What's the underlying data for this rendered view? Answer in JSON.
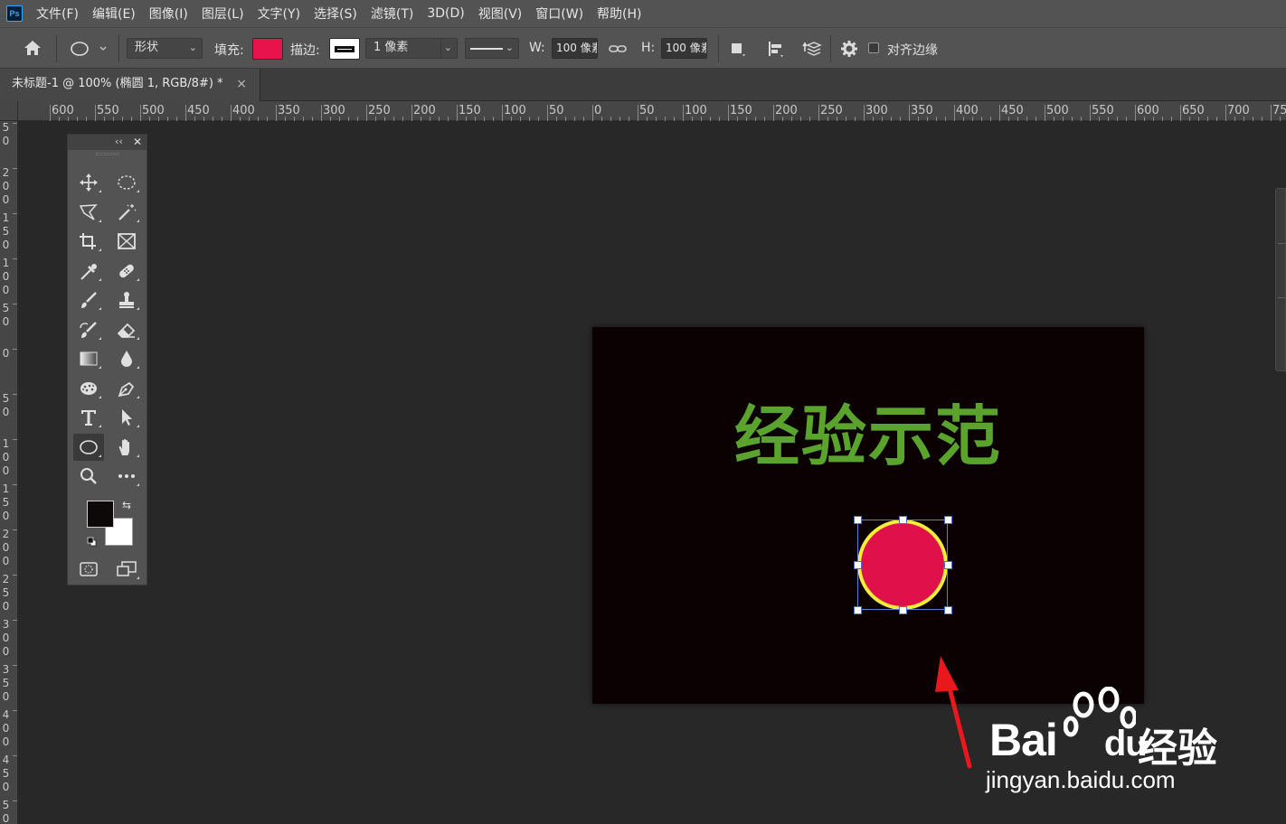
{
  "app": {
    "logo": "Ps"
  },
  "menu": [
    "文件(F)",
    "编辑(E)",
    "图像(I)",
    "图层(L)",
    "文字(Y)",
    "选择(S)",
    "滤镜(T)",
    "3D(D)",
    "视图(V)",
    "窗口(W)",
    "帮助(H)"
  ],
  "options": {
    "mode_value": "形状",
    "fill_label": "填充:",
    "fill_color": "#e8134a",
    "stroke_label": "描边:",
    "stroke_width_value": "1 像素",
    "w_label": "W:",
    "w_value": "100 像素",
    "h_label": "H:",
    "h_value": "100 像素",
    "align_edges_label": "对齐边缘"
  },
  "document": {
    "tab_title": "未标题-1 @ 100% (椭圆 1, RGB/8#) *",
    "tab_close": "×"
  },
  "ruler": {
    "top_labels": [
      "0",
      "600",
      "550",
      "500",
      "450",
      "400",
      "350",
      "300",
      "250",
      "200",
      "150",
      "100",
      "50",
      "0",
      "50",
      "100",
      "150",
      "200",
      "250",
      "300",
      "350",
      "400",
      "450",
      "500",
      "550",
      "600",
      "650",
      "700",
      "75"
    ],
    "left_labels": [
      "50",
      "200",
      "150",
      "100",
      "50",
      "0",
      "50",
      "100",
      "150",
      "200",
      "250",
      "300",
      "350",
      "400",
      "450",
      "500"
    ]
  },
  "canvas": {
    "text": "经验示范",
    "text_color": "#5aa32c",
    "background": "#0b0002",
    "ellipse_fill": "#e0104a",
    "ellipse_stroke": "#f6ec3a"
  },
  "toolbox": {
    "collapse_glyph": "‹‹",
    "close_glyph": "✕",
    "swap_glyph": "⇆",
    "tools": [
      {
        "name": "move-tool",
        "icon": "move-icon"
      },
      {
        "name": "elliptical-marquee-tool",
        "icon": "ellipse-marquee-icon"
      },
      {
        "name": "polygonal-lasso-tool",
        "icon": "lasso-icon"
      },
      {
        "name": "magic-wand-tool",
        "icon": "magic-wand-icon"
      },
      {
        "name": "crop-tool",
        "icon": "crop-icon"
      },
      {
        "name": "frame-tool",
        "icon": "frame-icon"
      },
      {
        "name": "eyedropper-tool",
        "icon": "eyedropper-icon"
      },
      {
        "name": "healing-brush-tool",
        "icon": "bandage-icon"
      },
      {
        "name": "brush-tool",
        "icon": "brush-icon"
      },
      {
        "name": "clone-stamp-tool",
        "icon": "stamp-icon"
      },
      {
        "name": "history-brush-tool",
        "icon": "history-brush-icon"
      },
      {
        "name": "eraser-tool",
        "icon": "eraser-icon"
      },
      {
        "name": "gradient-tool",
        "icon": "gradient-icon"
      },
      {
        "name": "blur-tool",
        "icon": "drop-icon"
      },
      {
        "name": "sponge-tool",
        "icon": "sponge-icon"
      },
      {
        "name": "pen-tool",
        "icon": "pen-icon"
      },
      {
        "name": "type-tool",
        "icon": "type-icon"
      },
      {
        "name": "path-selection-tool",
        "icon": "arrow-pointer-icon"
      },
      {
        "name": "ellipse-tool",
        "icon": "ellipse-icon"
      },
      {
        "name": "hand-tool",
        "icon": "hand-icon"
      },
      {
        "name": "zoom-tool",
        "icon": "magnifier-icon"
      },
      {
        "name": "more-tools",
        "icon": "ellipsis-icon"
      }
    ],
    "foreground_color": "#0d0909",
    "background_color": "#ffffff"
  },
  "watermark": {
    "brand": "Bai",
    "brand_suffix": "du",
    "cn": "经验",
    "url": "jingyan.baidu.com"
  },
  "colors": {
    "chrome": "#535353",
    "workspace": "#282828",
    "selection": "#5b7fd6",
    "annotation_arrow": "#e8181c"
  }
}
